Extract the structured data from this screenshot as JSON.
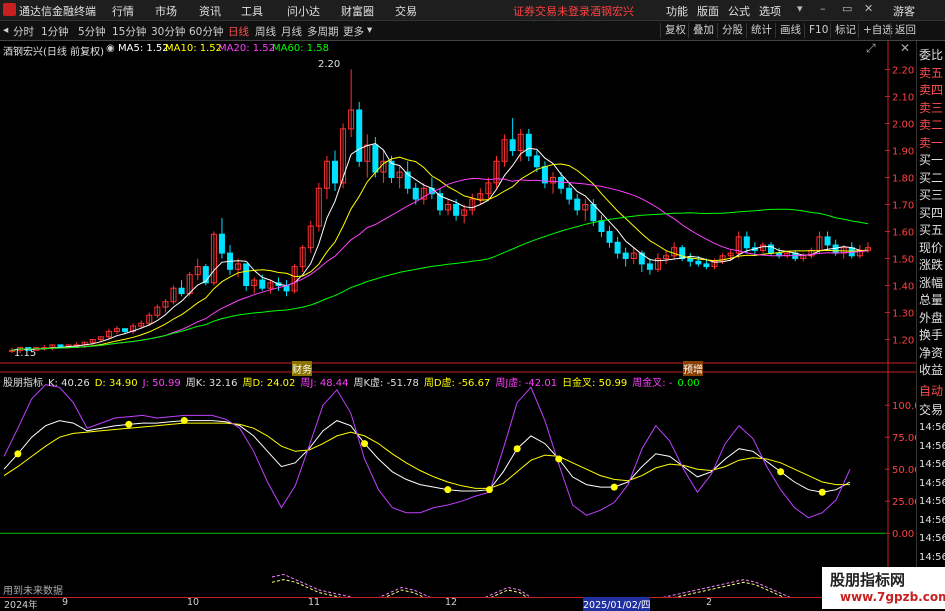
{
  "titlebar": {
    "app_name": "通达信金融终端",
    "menus": [
      "行情",
      "市场",
      "资讯",
      "工具",
      "问小达",
      "财富圈",
      "交易"
    ],
    "warning": "证券交易未登录",
    "stock_name": "酒钢宏兴",
    "right_menus": [
      "功能",
      "版面",
      "公式",
      "选项"
    ],
    "guest": "游客"
  },
  "periods": [
    "分时",
    "1分钟",
    "5分钟",
    "15分钟",
    "30分钟",
    "60分钟",
    "日线",
    "周线",
    "月线",
    "多周期",
    "更多"
  ],
  "active_period": "日线",
  "tools": [
    "复权",
    "叠加",
    "分股",
    "统计",
    "画线",
    "F10",
    "标记",
    "+自选",
    "返回"
  ],
  "stock_header": "酒钢宏兴(日线 前复权)",
  "ma": [
    {
      "label": "MA5: 1.52",
      "color": "#ffffff"
    },
    {
      "label": "MA10: 1.52",
      "color": "#ffff00"
    },
    {
      "label": "MA20: 1.52",
      "color": "#ff40ff"
    },
    {
      "label": "MA60: 1.58",
      "color": "#00ff00"
    }
  ],
  "price_axis": [
    "2.20",
    "2.10",
    "2.00",
    "1.90",
    "1.80",
    "1.70",
    "1.60",
    "1.50",
    "1.40",
    "1.30",
    "1.20"
  ],
  "high_label": "2.20",
  "low_label": "1.15",
  "events": [
    "财务",
    "预增"
  ],
  "kdj_header": [
    {
      "text": "股朋指标",
      "color": "#e0e0e0"
    },
    {
      "text": "K: 40.26",
      "color": "#e0e0e0"
    },
    {
      "text": "D: 34.90",
      "color": "#ffff00"
    },
    {
      "text": "J: 50.99",
      "color": "#ff40ff"
    },
    {
      "text": "周K: 32.16",
      "color": "#e0e0e0"
    },
    {
      "text": "周D: 24.02",
      "color": "#ffff00"
    },
    {
      "text": "周J: 48.44",
      "color": "#ff40ff"
    },
    {
      "text": "周K虚: -51.78",
      "color": "#e0e0e0"
    },
    {
      "text": "周D虚: -56.67",
      "color": "#ffff00"
    },
    {
      "text": "周J虚: -42.01",
      "color": "#ff40ff"
    },
    {
      "text": "日金叉: 50.99",
      "color": "#ffff00"
    },
    {
      "text": "周金叉: -",
      "color": "#ff40ff"
    },
    {
      "text": "0.00",
      "color": "#00ff00"
    }
  ],
  "kdj_axis": [
    "100.0",
    "75.00",
    "50.00",
    "25.00",
    "0.00"
  ],
  "future_label": "用到未来数据",
  "right_panel": {
    "items": [
      "委比",
      "卖五",
      "卖四",
      "卖三",
      "卖二",
      "卖一",
      "买一",
      "买二",
      "买三",
      "买四",
      "买五",
      "现价",
      "涨跌",
      "涨幅",
      "总量",
      "外盘",
      "换手",
      "净资",
      "收益"
    ],
    "lower": [
      "自动",
      "交易",
      "14:56",
      "14:56",
      "14:56",
      "14:56",
      "14:56",
      "14:56",
      "14:56",
      "14:56"
    ]
  },
  "dates": [
    "2024年",
    "9",
    "10",
    "11",
    "12",
    "2025/01/02/四",
    "2"
  ],
  "watermark": {
    "title": "股朋指标网",
    "url": "www.7gpzb.com"
  },
  "colors": {
    "up": "#ff3232",
    "down": "#00e0ff",
    "ma5": "#ffffff",
    "ma10": "#ffff00",
    "ma20": "#ff40ff",
    "ma60": "#00ff00"
  },
  "chart_data": [
    {
      "type": "candlestick",
      "title": "酒钢宏兴(日线 前复权)",
      "ylim": [
        1.15,
        2.25
      ],
      "ohlc": [
        [
          1.16,
          1.17,
          1.15,
          1.16
        ],
        [
          1.16,
          1.17,
          1.15,
          1.17
        ],
        [
          1.17,
          1.17,
          1.16,
          1.16
        ],
        [
          1.16,
          1.17,
          1.16,
          1.17
        ],
        [
          1.17,
          1.18,
          1.16,
          1.17
        ],
        [
          1.17,
          1.18,
          1.16,
          1.18
        ],
        [
          1.18,
          1.18,
          1.17,
          1.17
        ],
        [
          1.17,
          1.18,
          1.17,
          1.18
        ],
        [
          1.18,
          1.19,
          1.17,
          1.18
        ],
        [
          1.18,
          1.19,
          1.17,
          1.19
        ],
        [
          1.19,
          1.2,
          1.18,
          1.2
        ],
        [
          1.2,
          1.21,
          1.19,
          1.21
        ],
        [
          1.21,
          1.24,
          1.2,
          1.23
        ],
        [
          1.23,
          1.25,
          1.22,
          1.24
        ],
        [
          1.24,
          1.24,
          1.22,
          1.23
        ],
        [
          1.23,
          1.26,
          1.22,
          1.25
        ],
        [
          1.25,
          1.27,
          1.24,
          1.26
        ],
        [
          1.26,
          1.3,
          1.25,
          1.29
        ],
        [
          1.29,
          1.33,
          1.28,
          1.32
        ],
        [
          1.32,
          1.35,
          1.3,
          1.34
        ],
        [
          1.34,
          1.4,
          1.33,
          1.39
        ],
        [
          1.39,
          1.42,
          1.36,
          1.37
        ],
        [
          1.37,
          1.45,
          1.36,
          1.44
        ],
        [
          1.44,
          1.5,
          1.42,
          1.47
        ],
        [
          1.47,
          1.48,
          1.4,
          1.41
        ],
        [
          1.41,
          1.6,
          1.4,
          1.59
        ],
        [
          1.59,
          1.65,
          1.5,
          1.52
        ],
        [
          1.52,
          1.55,
          1.44,
          1.46
        ],
        [
          1.46,
          1.5,
          1.43,
          1.48
        ],
        [
          1.48,
          1.47,
          1.38,
          1.4
        ],
        [
          1.4,
          1.43,
          1.37,
          1.42
        ],
        [
          1.42,
          1.44,
          1.38,
          1.39
        ],
        [
          1.39,
          1.42,
          1.37,
          1.41
        ],
        [
          1.41,
          1.43,
          1.38,
          1.4
        ],
        [
          1.4,
          1.42,
          1.36,
          1.38
        ],
        [
          1.38,
          1.48,
          1.37,
          1.47
        ],
        [
          1.47,
          1.55,
          1.45,
          1.54
        ],
        [
          1.54,
          1.64,
          1.52,
          1.62
        ],
        [
          1.62,
          1.78,
          1.6,
          1.76
        ],
        [
          1.76,
          1.88,
          1.72,
          1.86
        ],
        [
          1.86,
          1.9,
          1.75,
          1.78
        ],
        [
          1.78,
          2.0,
          1.76,
          1.98
        ],
        [
          1.98,
          2.2,
          1.95,
          2.05
        ],
        [
          2.05,
          2.08,
          1.84,
          1.86
        ],
        [
          1.86,
          1.96,
          1.8,
          1.92
        ],
        [
          1.92,
          1.95,
          1.8,
          1.82
        ],
        [
          1.82,
          1.9,
          1.78,
          1.86
        ],
        [
          1.86,
          1.88,
          1.78,
          1.8
        ],
        [
          1.8,
          1.84,
          1.76,
          1.82
        ],
        [
          1.82,
          1.86,
          1.74,
          1.76
        ],
        [
          1.76,
          1.78,
          1.7,
          1.72
        ],
        [
          1.72,
          1.78,
          1.7,
          1.76
        ],
        [
          1.76,
          1.8,
          1.72,
          1.74
        ],
        [
          1.74,
          1.76,
          1.66,
          1.68
        ],
        [
          1.68,
          1.72,
          1.66,
          1.7
        ],
        [
          1.7,
          1.72,
          1.64,
          1.66
        ],
        [
          1.66,
          1.7,
          1.63,
          1.68
        ],
        [
          1.68,
          1.74,
          1.66,
          1.72
        ],
        [
          1.72,
          1.76,
          1.7,
          1.74
        ],
        [
          1.74,
          1.8,
          1.72,
          1.78
        ],
        [
          1.78,
          1.88,
          1.76,
          1.86
        ],
        [
          1.86,
          1.96,
          1.84,
          1.94
        ],
        [
          1.94,
          2.02,
          1.88,
          1.9
        ],
        [
          1.9,
          1.98,
          1.86,
          1.96
        ],
        [
          1.96,
          1.98,
          1.86,
          1.88
        ],
        [
          1.88,
          1.9,
          1.82,
          1.84
        ],
        [
          1.84,
          1.86,
          1.76,
          1.78
        ],
        [
          1.78,
          1.82,
          1.74,
          1.8
        ],
        [
          1.8,
          1.82,
          1.74,
          1.76
        ],
        [
          1.76,
          1.78,
          1.7,
          1.72
        ],
        [
          1.72,
          1.74,
          1.66,
          1.68
        ],
        [
          1.68,
          1.72,
          1.64,
          1.7
        ],
        [
          1.7,
          1.72,
          1.62,
          1.64
        ],
        [
          1.64,
          1.66,
          1.58,
          1.6
        ],
        [
          1.6,
          1.62,
          1.54,
          1.56
        ],
        [
          1.56,
          1.58,
          1.5,
          1.52
        ],
        [
          1.52,
          1.54,
          1.47,
          1.5
        ],
        [
          1.5,
          1.54,
          1.48,
          1.52
        ],
        [
          1.52,
          1.53,
          1.45,
          1.48
        ],
        [
          1.48,
          1.5,
          1.44,
          1.46
        ],
        [
          1.46,
          1.52,
          1.45,
          1.5
        ],
        [
          1.5,
          1.53,
          1.48,
          1.51
        ],
        [
          1.51,
          1.56,
          1.5,
          1.54
        ],
        [
          1.54,
          1.55,
          1.49,
          1.5
        ],
        [
          1.5,
          1.52,
          1.47,
          1.49
        ],
        [
          1.49,
          1.51,
          1.47,
          1.48
        ],
        [
          1.48,
          1.5,
          1.46,
          1.47
        ],
        [
          1.47,
          1.5,
          1.46,
          1.49
        ],
        [
          1.49,
          1.52,
          1.48,
          1.51
        ],
        [
          1.51,
          1.53,
          1.49,
          1.52
        ],
        [
          1.52,
          1.6,
          1.5,
          1.58
        ],
        [
          1.58,
          1.6,
          1.52,
          1.54
        ],
        [
          1.54,
          1.56,
          1.51,
          1.53
        ],
        [
          1.53,
          1.56,
          1.52,
          1.55
        ],
        [
          1.55,
          1.56,
          1.51,
          1.52
        ],
        [
          1.52,
          1.54,
          1.5,
          1.51
        ],
        [
          1.51,
          1.53,
          1.5,
          1.52
        ],
        [
          1.52,
          1.53,
          1.49,
          1.5
        ],
        [
          1.5,
          1.52,
          1.49,
          1.51
        ],
        [
          1.51,
          1.54,
          1.5,
          1.53
        ],
        [
          1.53,
          1.6,
          1.52,
          1.58
        ],
        [
          1.58,
          1.6,
          1.53,
          1.55
        ],
        [
          1.55,
          1.57,
          1.51,
          1.52
        ],
        [
          1.52,
          1.55,
          1.5,
          1.54
        ],
        [
          1.54,
          1.56,
          1.5,
          1.51
        ],
        [
          1.51,
          1.55,
          1.5,
          1.53
        ],
        [
          1.53,
          1.56,
          1.52,
          1.54
        ]
      ]
    },
    {
      "type": "line",
      "title": "股朋指标",
      "ylim": [
        -10,
        115
      ],
      "series": [
        {
          "name": "K",
          "values": [
            50,
            62,
            75,
            84,
            88,
            86,
            80,
            82,
            84,
            85,
            86,
            86,
            87,
            88,
            88,
            88,
            87,
            84,
            76,
            64,
            52,
            55,
            66,
            80,
            88,
            84,
            70,
            58,
            48,
            42,
            38,
            36,
            34,
            33,
            33,
            34,
            48,
            66,
            76,
            70,
            58,
            44,
            38,
            36,
            36,
            40,
            52,
            62,
            60,
            52,
            44,
            48,
            58,
            66,
            64,
            56,
            48,
            40,
            34,
            32,
            34,
            40
          ]
        },
        {
          "name": "D",
          "values": [
            45,
            52,
            60,
            68,
            75,
            78,
            79,
            80,
            81,
            82,
            83,
            84,
            85,
            86,
            86,
            86,
            86,
            85,
            82,
            76,
            68,
            64,
            65,
            70,
            76,
            79,
            76,
            70,
            62,
            55,
            49,
            44,
            40,
            37,
            35,
            35,
            39,
            48,
            57,
            61,
            60,
            55,
            50,
            45,
            42,
            41,
            45,
            51,
            54,
            53,
            50,
            49,
            52,
            57,
            59,
            58,
            55,
            50,
            45,
            40,
            38,
            38
          ]
        },
        {
          "name": "J",
          "values": [
            60,
            82,
            105,
            116,
            114,
            102,
            82,
            86,
            90,
            91,
            92,
            90,
            91,
            92,
            92,
            92,
            89,
            82,
            64,
            40,
            20,
            37,
            68,
            100,
            112,
            94,
            58,
            34,
            20,
            16,
            16,
            20,
            22,
            25,
            29,
            32,
            66,
            102,
            114,
            88,
            54,
            22,
            14,
            18,
            24,
            38,
            66,
            84,
            72,
            50,
            32,
            46,
            70,
            84,
            74,
            52,
            34,
            20,
            12,
            16,
            26,
            50
          ]
        },
        {
          "name": "周K虚",
          "values": [
            -20,
            -18,
            -22,
            -26,
            -30,
            -32,
            -34,
            -36,
            -38,
            -36,
            -32,
            -28,
            -30,
            -34,
            -38,
            -40,
            -42,
            -40,
            -36,
            -32,
            -28,
            -30,
            -36,
            -42,
            -46,
            -48,
            -52,
            -50,
            -46,
            -44,
            -42,
            -40,
            -38,
            -36,
            -34,
            -32,
            -30,
            -28,
            -26,
            -24,
            -22,
            -24,
            -28,
            -32,
            -36,
            -40,
            -44,
            -48,
            -50,
            -52
          ]
        },
        {
          "name": "周D虚",
          "values": [
            -24,
            -22,
            -24,
            -28,
            -32,
            -34,
            -36,
            -38,
            -40,
            -38,
            -34,
            -30,
            -32,
            -36,
            -40,
            -42,
            -44,
            -42,
            -38,
            -34,
            -30,
            -32,
            -38,
            -44,
            -48,
            -50,
            -54,
            -52,
            -48,
            -46,
            -44,
            -42,
            -40,
            -38,
            -36,
            -34,
            -32,
            -30,
            -28,
            -26,
            -24,
            -26,
            -30,
            -34,
            -38,
            -42,
            -46,
            -50,
            -52,
            -56
          ]
        }
      ],
      "golden_cross_points": [
        1,
        16,
        22,
        45,
        55,
        61,
        64,
        69,
        77,
        97,
        103
      ]
    }
  ]
}
